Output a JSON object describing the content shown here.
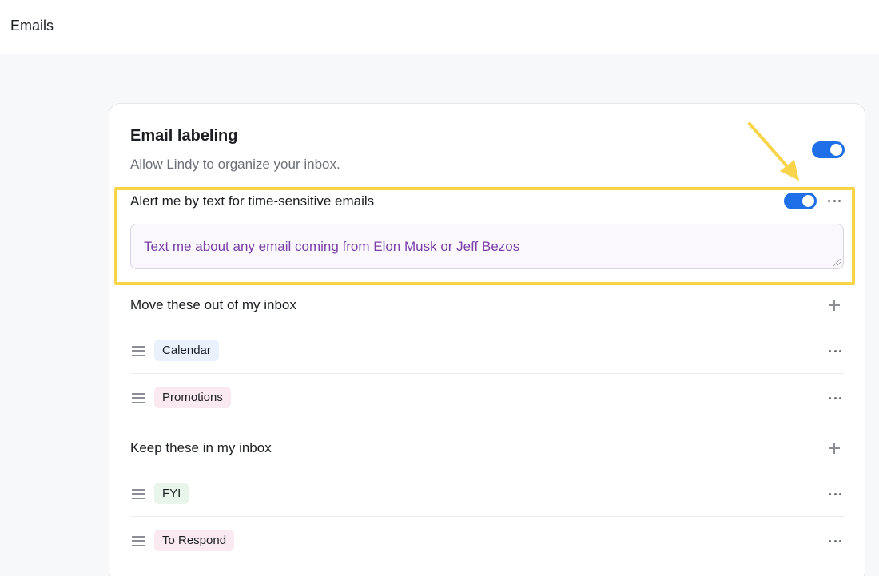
{
  "header": {
    "title": "Emails"
  },
  "card": {
    "title": "Email labeling",
    "subtitle": "Allow Lindy to organize your inbox.",
    "enabled": true
  },
  "alert": {
    "label": "Alert me by text for time-sensitive emails",
    "enabled": true,
    "instruction_value": "Text me about any email coming from Elon Musk or Jeff Bezos"
  },
  "move_out": {
    "heading": "Move these out of my inbox",
    "labels": [
      {
        "name": "Calendar",
        "color": "#e8f1fc"
      },
      {
        "name": "Promotions",
        "color": "#fbe9f1"
      }
    ]
  },
  "keep_in": {
    "heading": "Keep these in my inbox",
    "labels": [
      {
        "name": "FYI",
        "color": "#e7f5ea"
      },
      {
        "name": "To Respond",
        "color": "#fbe9f1"
      }
    ]
  },
  "colors": {
    "accent": "#1f6fe8",
    "highlight": "#f7d44a",
    "instruction_text": "#7a3fa8"
  },
  "icons": [
    "more-horizontal-icon",
    "plus-icon",
    "drag-handle-icon",
    "arrow-annotation"
  ]
}
